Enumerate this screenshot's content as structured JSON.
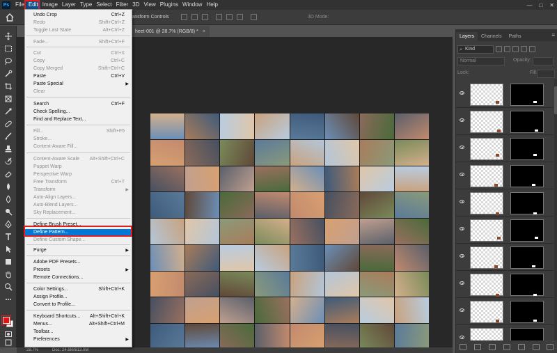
{
  "menubar": {
    "logo": "Ps",
    "items": [
      "File",
      "Edit",
      "Image",
      "Layer",
      "Type",
      "Select",
      "Filter",
      "3D",
      "View",
      "Plugins",
      "Window",
      "Help"
    ],
    "window_controls": [
      "—",
      "□",
      "✕"
    ]
  },
  "options_bar": {
    "transform_controls": "Transform Controls",
    "mode_3d": "3D Mode:"
  },
  "document_tab": {
    "title": "heet-001 @ 28.7% (RGB/8) *",
    "close": "×"
  },
  "edit_menu": {
    "items": [
      {
        "label": "Undo Crop",
        "shortcut": "Ctrl+Z",
        "state": "enabled"
      },
      {
        "label": "Redo",
        "shortcut": "Shift+Ctrl+Z",
        "state": "disabled"
      },
      {
        "label": "Toggle Last State",
        "shortcut": "Alt+Ctrl+Z",
        "state": "disabled"
      },
      {
        "label": "Fade...",
        "shortcut": "Shift+Ctrl+F",
        "state": "disabled"
      },
      {
        "label": "Cut",
        "shortcut": "Ctrl+X",
        "state": "disabled"
      },
      {
        "label": "Copy",
        "shortcut": "Ctrl+C",
        "state": "disabled"
      },
      {
        "label": "Copy Merged",
        "shortcut": "Shift+Ctrl+C",
        "state": "disabled"
      },
      {
        "label": "Paste",
        "shortcut": "Ctrl+V",
        "state": "enabled"
      },
      {
        "label": "Paste Special",
        "shortcut": "",
        "state": "enabled",
        "submenu": true
      },
      {
        "label": "Clear",
        "shortcut": "",
        "state": "disabled"
      },
      {
        "label": "Search",
        "shortcut": "Ctrl+F",
        "state": "enabled"
      },
      {
        "label": "Check Spelling...",
        "shortcut": "",
        "state": "enabled"
      },
      {
        "label": "Find and Replace Text...",
        "shortcut": "",
        "state": "enabled"
      },
      {
        "label": "Fill...",
        "shortcut": "Shift+F5",
        "state": "disabled"
      },
      {
        "label": "Stroke...",
        "shortcut": "",
        "state": "disabled"
      },
      {
        "label": "Content-Aware Fill...",
        "shortcut": "",
        "state": "disabled"
      },
      {
        "label": "Content-Aware Scale",
        "shortcut": "Alt+Shift+Ctrl+C",
        "state": "disabled"
      },
      {
        "label": "Puppet Warp",
        "shortcut": "",
        "state": "disabled"
      },
      {
        "label": "Perspective Warp",
        "shortcut": "",
        "state": "disabled"
      },
      {
        "label": "Free Transform",
        "shortcut": "Ctrl+T",
        "state": "disabled"
      },
      {
        "label": "Transform",
        "shortcut": "",
        "state": "disabled",
        "submenu": true
      },
      {
        "label": "Auto-Align Layers...",
        "shortcut": "",
        "state": "disabled"
      },
      {
        "label": "Auto-Blend Layers...",
        "shortcut": "",
        "state": "disabled"
      },
      {
        "label": "Sky Replacement...",
        "shortcut": "",
        "state": "disabled"
      },
      {
        "label": "Define Brush Preset...",
        "shortcut": "",
        "state": "enabled"
      },
      {
        "label": "Define Pattern...",
        "shortcut": "",
        "state": "selected"
      },
      {
        "label": "Define Custom Shape...",
        "shortcut": "",
        "state": "disabled"
      },
      {
        "label": "Purge",
        "shortcut": "",
        "state": "enabled",
        "submenu": true
      },
      {
        "label": "Adobe PDF Presets...",
        "shortcut": "",
        "state": "enabled"
      },
      {
        "label": "Presets",
        "shortcut": "",
        "state": "enabled",
        "submenu": true
      },
      {
        "label": "Remote Connections...",
        "shortcut": "",
        "state": "enabled"
      },
      {
        "label": "Color Settings...",
        "shortcut": "Shift+Ctrl+K",
        "state": "enabled"
      },
      {
        "label": "Assign Profile...",
        "shortcut": "",
        "state": "enabled"
      },
      {
        "label": "Convert to Profile...",
        "shortcut": "",
        "state": "enabled"
      },
      {
        "label": "Keyboard Shortcuts...",
        "shortcut": "Alt+Shift+Ctrl+K",
        "state": "enabled"
      },
      {
        "label": "Menus...",
        "shortcut": "Alt+Shift+Ctrl+M",
        "state": "enabled"
      },
      {
        "label": "Toolbar...",
        "shortcut": "",
        "state": "enabled"
      },
      {
        "label": "Preferences",
        "shortcut": "",
        "state": "enabled",
        "submenu": true
      }
    ],
    "submenu_arrow": "▶"
  },
  "toolbar": {
    "tools": [
      "move-tool",
      "marquee-tool",
      "lasso-tool",
      "quick-select-tool",
      "crop-tool",
      "frame-tool",
      "eyedropper-tool",
      "healing-tool",
      "brush-tool",
      "stamp-tool",
      "history-brush-tool",
      "eraser-tool",
      "gradient-tool",
      "blur-tool",
      "dodge-tool",
      "pen-tool",
      "type-tool",
      "path-select-tool",
      "shape-tool",
      "hand-tool",
      "zoom-tool",
      "more-tools"
    ],
    "foreground_color": "#e01414",
    "background_color": "#ffffff"
  },
  "statusbar": {
    "zoom": "28.7%",
    "doc": "Doc: 24.6M/813.0M"
  },
  "layers_panel": {
    "tabs": [
      "Layers",
      "Channels",
      "Paths"
    ],
    "active_tab": "Layers",
    "kind_label": "Kind",
    "blend_mode": "Normal",
    "opacity_label": "Opacity:",
    "lock_label": "Lock:",
    "fill_label": "Fill:",
    "layer_count_visible": 10
  },
  "collage": {
    "rows": 9,
    "cols": 8
  }
}
